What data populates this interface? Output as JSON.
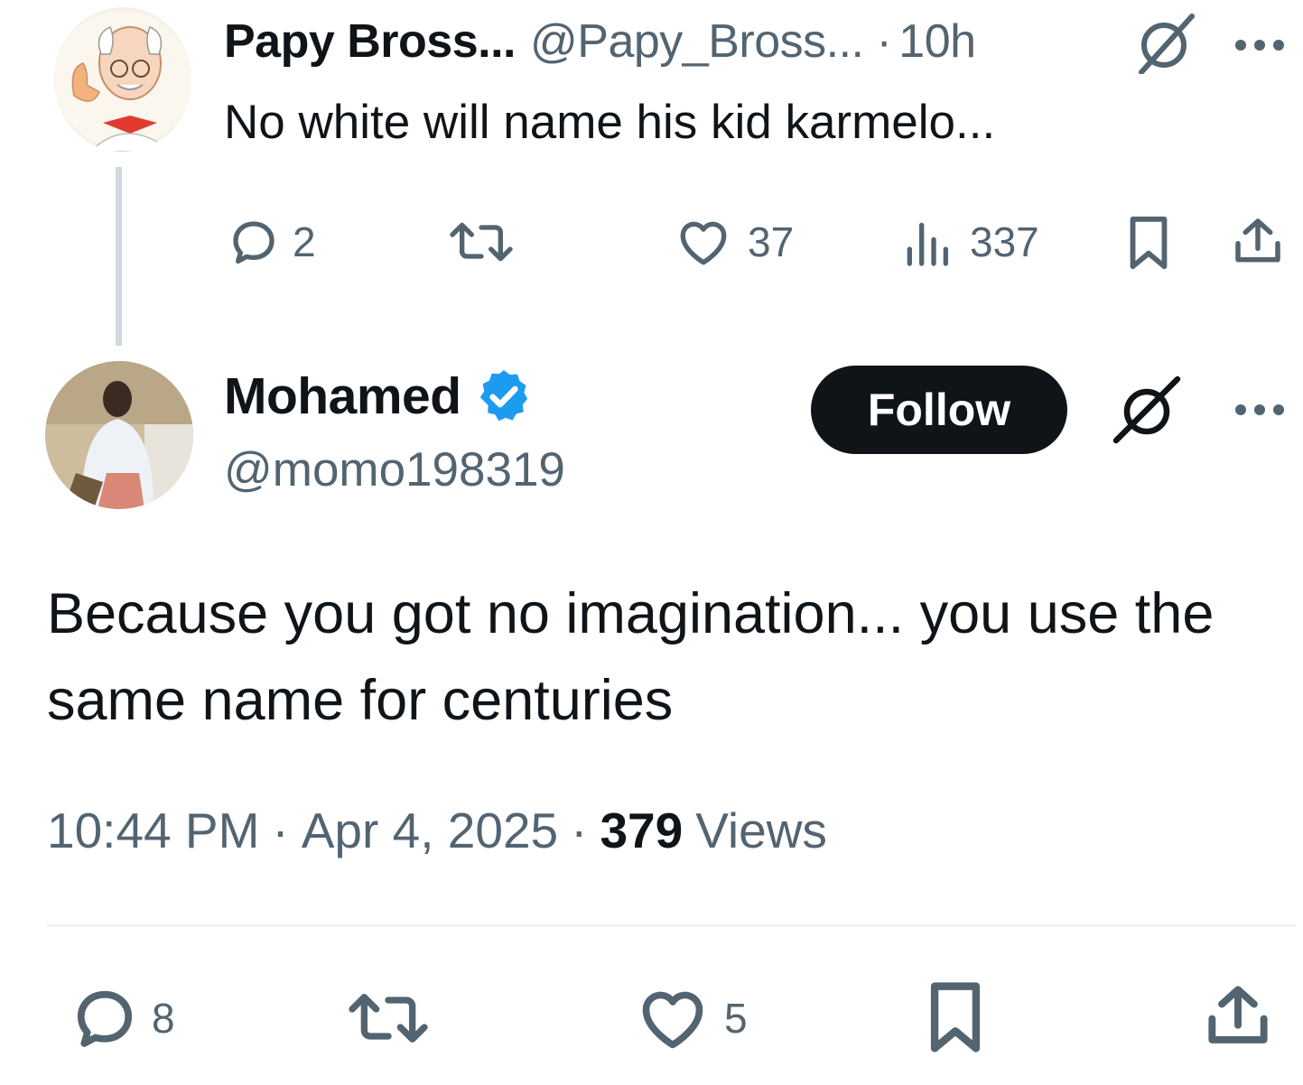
{
  "parent_tweet": {
    "display_name": "Papy Bross...",
    "handle": "@Papy_Bross...",
    "separator": "·",
    "time": "10h",
    "text": "No white will name his kid karmelo...",
    "actions": {
      "replies": "2",
      "retweets": "",
      "likes": "37",
      "views": "337"
    }
  },
  "main_tweet": {
    "display_name": "Mohamed",
    "handle": "@momo198319",
    "follow_label": "Follow",
    "text": "Because you got no imagination... you use the same name for centuries",
    "time": "10:44 PM",
    "sep1": "·",
    "date": "Apr 4, 2025",
    "sep2": "·",
    "views_count": "379",
    "views_label": "Views",
    "actions": {
      "replies": "8",
      "retweets": "",
      "likes": "5"
    }
  },
  "colors": {
    "text": "#0f1419",
    "muted": "#536471",
    "verified": "#1d9bf0",
    "follow_bg": "#0f1419",
    "divider": "#eff3f4"
  },
  "icons": [
    "grok-icon",
    "more-icon",
    "reply-icon",
    "retweet-icon",
    "like-icon",
    "views-icon",
    "bookmark-icon",
    "share-icon",
    "verified-badge-icon"
  ]
}
